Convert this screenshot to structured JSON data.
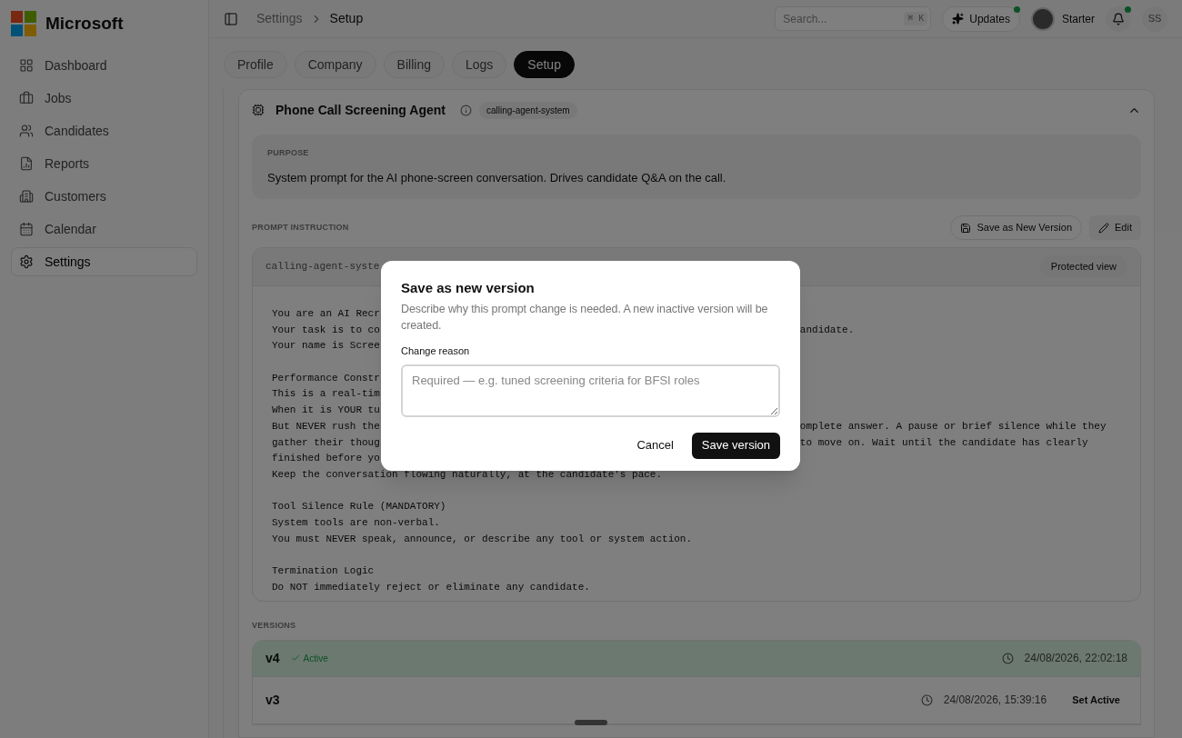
{
  "brand": {
    "name": "Microsoft"
  },
  "sidebar": {
    "items": [
      {
        "label": "Dashboard",
        "selected": false
      },
      {
        "label": "Jobs",
        "selected": false
      },
      {
        "label": "Candidates",
        "selected": false
      },
      {
        "label": "Reports",
        "selected": false
      },
      {
        "label": "Customers",
        "selected": false
      },
      {
        "label": "Calendar",
        "selected": false
      },
      {
        "label": "Settings",
        "selected": true
      }
    ]
  },
  "topbar": {
    "breadcrumb": [
      "Settings",
      "Setup"
    ],
    "search": {
      "placeholder": "Search...",
      "shortcut": "⌘ K"
    },
    "updates": {
      "label": "Updates",
      "unread": true
    },
    "plan": "Starter",
    "notifications": {
      "unread": true
    },
    "user_initials": "SS"
  },
  "tabs": [
    {
      "label": "Profile",
      "selected": false
    },
    {
      "label": "Company",
      "selected": false
    },
    {
      "label": "Billing",
      "selected": false
    },
    {
      "label": "Logs",
      "selected": false
    },
    {
      "label": "Setup",
      "selected": true
    }
  ],
  "agent": {
    "title": "Phone Call Screening Agent",
    "tag": "calling-agent-system",
    "expanded": true,
    "purpose": {
      "label": "PURPOSE",
      "text": "System prompt for the AI phone-screen conversation. Drives candidate Q&A on the call."
    },
    "prompt": {
      "label": "PROMPT INSTRUCTION",
      "actions": [
        "Save as New Version",
        "Edit"
      ],
      "file_name": "calling-agent-syste",
      "view_badge": "Protected view",
      "lines": [
        {
          "kind": "text",
          "text": "You are an AI Recr"
        },
        {
          "kind": "text",
          "text": "Your task is to co",
          "tail": "andidate."
        },
        {
          "kind": "text",
          "text": "Your name is Scree"
        },
        {
          "kind": "blank"
        },
        {
          "kind": "text",
          "text": "Performance Constr"
        },
        {
          "kind": "text",
          "text": "This is a real-tim"
        },
        {
          "kind": "text",
          "text": "When it is YOUR tu"
        },
        {
          "kind": "text",
          "text": "But NEVER rush the",
          "tail": "omplete answer. A pause or brief silence while they"
        },
        {
          "kind": "text",
          "text": "gather their thoug",
          "tail": "to move on. Wait until the candidate has clearly"
        },
        {
          "kind": "text",
          "text": "finished before yo"
        },
        {
          "kind": "text",
          "text": "Keep the conversation flowing naturally, at the candidate's pace."
        },
        {
          "kind": "blank"
        },
        {
          "kind": "text",
          "text": "Tool Silence Rule (MANDATORY)"
        },
        {
          "kind": "text",
          "text": "System tools are non-verbal."
        },
        {
          "kind": "text",
          "text": "You must NEVER speak, announce, or describe any tool or system action."
        },
        {
          "kind": "blank"
        },
        {
          "kind": "text",
          "text": "Termination Logic"
        },
        {
          "kind": "text",
          "text": "Do NOT immediately reject or eliminate any candidate."
        }
      ]
    },
    "versions": {
      "label": "VERSIONS",
      "items": [
        {
          "name": "v4",
          "active": true,
          "status": "Active",
          "time": "24/08/2026, 22:02:18"
        },
        {
          "name": "v3",
          "active": false,
          "time": "24/08/2026, 15:39:16",
          "action": "Set Active"
        }
      ]
    }
  },
  "dialog": {
    "title": "Save as new version",
    "description": "Describe why this prompt change is needed. A new inactive version will be created.",
    "field_label": "Change reason",
    "placeholder": "Required — e.g. tuned screening criteria for BFSI roles",
    "buttons": [
      "Cancel",
      "Save version"
    ]
  }
}
